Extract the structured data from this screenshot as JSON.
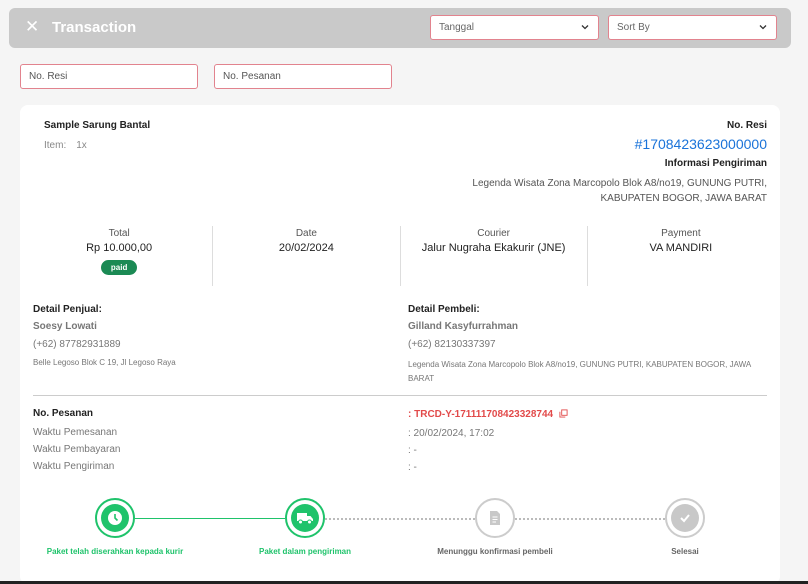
{
  "header": {
    "close_icon_glyph": "✕",
    "title": "Transaction",
    "date_select": "Tanggal",
    "sort_select": "Sort By"
  },
  "filters": {
    "resi_placeholder": "No. Resi",
    "pesanan_placeholder": "No. Pesanan"
  },
  "product": {
    "name": "Sample Sarung Bantal",
    "item_label": "Item:",
    "item_qty": "1x"
  },
  "resi": {
    "label": "No. Resi",
    "number": "#1708423623000000",
    "shipping_label": "Informasi Pengiriman",
    "shipping_address": "Legenda Wisata Zona Marcopolo Blok A8/no19, GUNUNG PUTRI, KABUPATEN BOGOR, JAWA BARAT"
  },
  "summary": {
    "total_label": "Total",
    "total_value": "Rp 10.000,00",
    "status_badge": "paid",
    "date_label": "Date",
    "date_value": "20/02/2024",
    "courier_label": "Courier",
    "courier_value": "Jalur Nugraha Ekakurir (JNE)",
    "payment_label": "Payment",
    "payment_value": "VA MANDIRI"
  },
  "seller": {
    "heading": "Detail Penjual:",
    "name": "Soesy Lowati",
    "phone": "(+62) 87782931889",
    "address": "Belle Legoso Blok C 19, Jl Legoso Raya"
  },
  "buyer": {
    "heading": "Detail Pembeli:",
    "name": "Gilland Kasyfurrahman",
    "phone": "(+62) 82130337397",
    "address": "Legenda Wisata Zona Marcopolo Blok A8/no19, GUNUNG PUTRI, KABUPATEN BOGOR, JAWA BARAT"
  },
  "order": {
    "no_label": "No. Pesanan",
    "no_value": ": TRCD-Y-171111708423328744",
    "order_time_label": "Waktu Pemesanan",
    "order_time_value": ": 20/02/2024, 17:02",
    "payment_time_label": "Waktu Pembayaran",
    "payment_time_value": ": -",
    "shipping_time_label": "Waktu Pengiriman",
    "shipping_time_value": ": -"
  },
  "steps": [
    {
      "label": "Paket telah diserahkan kepada kurir",
      "icon": "clock-icon",
      "state": "done"
    },
    {
      "label": "Paket dalam pengiriman",
      "icon": "truck-icon",
      "state": "done"
    },
    {
      "label": "Menunggu konfirmasi pembeli",
      "icon": "document-icon",
      "state": "todo"
    },
    {
      "label": "Selesai",
      "icon": "check-icon",
      "state": "todo"
    }
  ],
  "colors": {
    "accent_green": "#1fc36b",
    "link_blue": "#1a73d9",
    "code_red": "#e24a4a",
    "badge_green": "#1b8a54",
    "input_border": "#e2838e"
  }
}
